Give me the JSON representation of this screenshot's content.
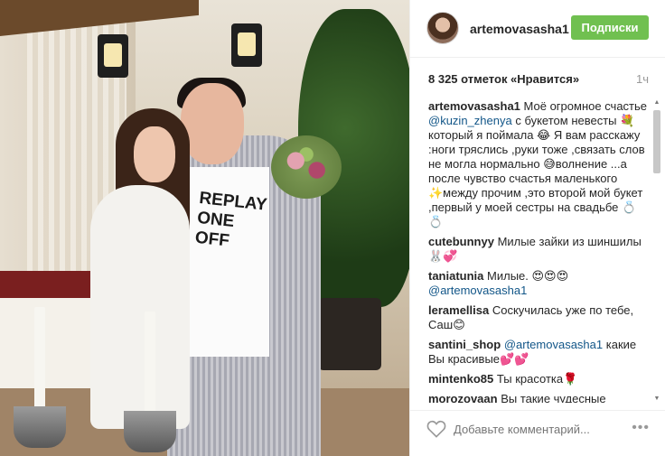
{
  "post": {
    "image_alt": "Photo of a couple with a bouquet",
    "shirt_text": "REPLAY ONE OFF"
  },
  "header": {
    "username": "artemovasasha1",
    "follow_label": "Подписки"
  },
  "likes": {
    "text": "8 325 отметок «Нравится»",
    "time": "1ч"
  },
  "comments": [
    {
      "user": "artemovasasha1",
      "pre": "Моё огромное счастье",
      "mention": "@kuzin_zhenya",
      "text": "с букетом невесты 💐 который я поймала 😂 Я вам расскажу :ноги тряслись ,руки тоже ,связать слов не могла нормально 😅волнение ...а после чувство счастья маленького ✨между прочим ,это второй мой букет ,первый у моей сестры на свадьбе 💍💍"
    },
    {
      "user": "cutebunnyy",
      "pre": "",
      "mention": "",
      "text": "Милые зайки из шиншилы 🐰💞"
    },
    {
      "user": "taniatunia",
      "pre": "Милые. 😍😍😍",
      "mention": "@artemovasasha1",
      "text": ""
    },
    {
      "user": "leramellisa",
      "pre": "",
      "mention": "",
      "text": "Соскучилась уже по тебе, Саш😊"
    },
    {
      "user": "santini_shop",
      "pre": "",
      "mention": "@artemovasasha1",
      "text": "какие Вы красивые💕💕"
    },
    {
      "user": "mintenko85",
      "pre": "",
      "mention": "",
      "text": "Ты красотка🌹"
    },
    {
      "user": "morozovaan",
      "pre": "",
      "mention": "",
      "text": "Вы такие чудесные"
    }
  ],
  "footer": {
    "comment_placeholder": "Добавьте комментарий...",
    "more_label": "•••"
  }
}
